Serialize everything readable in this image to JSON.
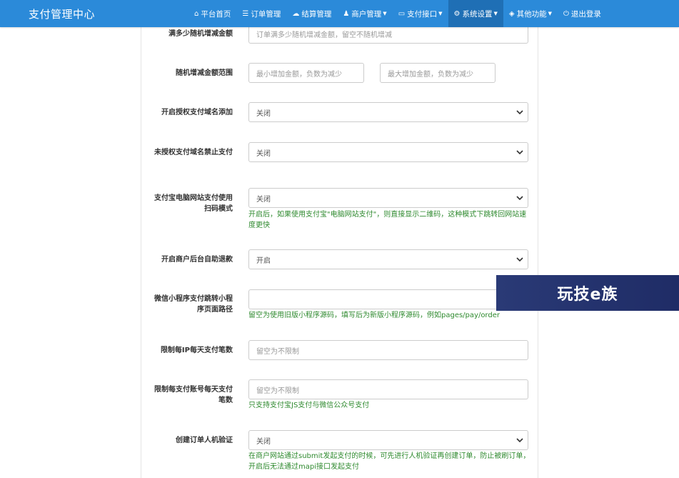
{
  "app": {
    "brand": "支付管理中心"
  },
  "nav": {
    "items": [
      {
        "icon": "home-icon",
        "label": "平台首页"
      },
      {
        "icon": "list-icon",
        "label": "订单管理"
      },
      {
        "icon": "cloud-icon",
        "label": "结算管理"
      },
      {
        "icon": "user-icon",
        "label": "商户管理"
      },
      {
        "icon": "card-icon",
        "label": "支付接口"
      },
      {
        "icon": "gear-icon",
        "label": "系统设置"
      },
      {
        "icon": "cube-icon",
        "label": "其他功能"
      },
      {
        "icon": "power-icon",
        "label": "退出登录"
      }
    ],
    "active_index": 5
  },
  "form": {
    "rows": [
      {
        "label": "满多少随机增减金额",
        "placeholder": "订单满多少随机增减金额，留空不随机增减"
      },
      {
        "label": "随机增减金额范围",
        "placeholder_min": "最小增加金额，负数为减少",
        "placeholder_max": "最大增加金额，负数为减少"
      },
      {
        "label": "开启授权支付域名添加",
        "value": "关闭"
      },
      {
        "label": "未授权支付域名禁止支付",
        "value": "关闭"
      },
      {
        "label": "支付宝电脑网站支付使用扫码模式",
        "value": "关闭",
        "help": "开启后，如果使用支付宝\"电脑网站支付\"，则直接显示二维码，这种模式下跳转回网站速度更快"
      },
      {
        "label": "开启商户后台自助退款",
        "value": "开启"
      },
      {
        "label": "微信小程序支付跳转小程序页面路径",
        "value": "",
        "help": "留空为使用旧版小程序源码，填写后为新版小程序源码，例如pages/pay/order"
      },
      {
        "label": "限制每IP每天支付笔数",
        "placeholder": "留空为不限制"
      },
      {
        "label": "限制每支付账号每天支付笔数",
        "placeholder": "留空为不限制",
        "help": "只支持支付宝JS支付与微信公众号支付"
      },
      {
        "label": "创建订单人机验证",
        "value": "关闭",
        "help": "在商户网站通过submit发起支付的时候，可先进行人机验证再创建订单，防止被刷订单，开启后无法通过mapi接口发起支付"
      }
    ]
  },
  "watermark": {
    "text": "玩技e族"
  }
}
